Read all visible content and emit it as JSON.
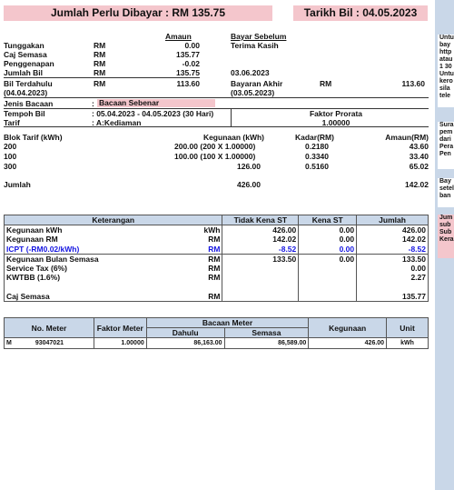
{
  "header": {
    "total_due": "Jumlah Perlu Dibayar : RM 135.75",
    "bill_date": "Tarikh Bil : 04.05.2023"
  },
  "summary": {
    "col_amount": "Amaun",
    "col_pay_before": "Bayar Sebelum",
    "thanks": "Terima Kasih",
    "rows": [
      {
        "label": "Tunggakan",
        "unit": "RM",
        "amount": "0.00"
      },
      {
        "label": "Caj Semasa",
        "unit": "RM",
        "amount": "135.77"
      },
      {
        "label": "Penggenapan",
        "unit": "RM",
        "amount": "-0.02"
      },
      {
        "label": "Jumlah Bil",
        "unit": "RM",
        "amount": "135.75",
        "date": "03.06.2023"
      }
    ],
    "prev_bill_label": "Bil Terdahulu",
    "prev_bill_date": "(04.04.2023)",
    "prev_bill_unit": "RM",
    "prev_bill_amount": "113.60",
    "last_payment_label": "Bayaran Akhir",
    "last_payment_date": "(03.05.2023)",
    "last_payment_unit": "RM",
    "last_payment_amount": "113.60"
  },
  "reading": {
    "type_label": "Jenis Bacaan",
    "type_value": "Bacaan Sebenar",
    "period_label": "Tempoh Bil",
    "period_value": ": 05.04.2023 - 04.05.2023 (30 Hari)",
    "tariff_label": "Tarif",
    "tariff_value": ": A:Kediaman",
    "prorate_label": "Faktor Prorata",
    "prorate_value": "1.00000"
  },
  "blocks": {
    "h_block": "Blok Tarif (kWh)",
    "h_usage": "Kegunaan (kWh)",
    "h_rate": "Kadar(RM)",
    "h_amount": "Amaun(RM)",
    "rows": [
      {
        "block": "200",
        "usage": "200.00  (200 X 1.00000)",
        "rate": "0.2180",
        "amount": "43.60"
      },
      {
        "block": "100",
        "usage": "100.00  (100 X 1.00000)",
        "rate": "0.3340",
        "amount": "33.40"
      },
      {
        "block": "300",
        "usage": "126.00",
        "rate": "0.5160",
        "amount": "65.02"
      }
    ],
    "total_label": "Jumlah",
    "total_usage": "426.00",
    "total_amount": "142.02"
  },
  "usage_table": {
    "headers": [
      "Keterangan",
      "Tidak Kena ST",
      "Kena ST",
      "Jumlah"
    ],
    "rows": [
      {
        "label": "Kegunaan kWh",
        "unit": "kWh",
        "a": "426.00",
        "b": "0.00",
        "c": "426.00"
      },
      {
        "label": "Kegunaan RM",
        "unit": "RM",
        "a": "142.02",
        "b": "0.00",
        "c": "142.02"
      },
      {
        "label": "ICPT (-RM0.02/kWh)",
        "unit": "RM",
        "a": "-8.52",
        "b": "0.00",
        "c": "-8.52"
      },
      {
        "label": "Kegunaan Bulan Semasa",
        "unit": "RM",
        "a": "133.50",
        "b": "0.00",
        "c": "133.50"
      },
      {
        "label": "Service Tax (6%)",
        "unit": "RM",
        "a": "",
        "b": "",
        "c": "0.00"
      },
      {
        "label": "KWTBB (1.6%)",
        "unit": "RM",
        "a": "",
        "b": "",
        "c": "2.27"
      },
      {
        "label": "Caj Semasa",
        "unit": "RM",
        "a": "",
        "b": "",
        "c": "135.77"
      }
    ]
  },
  "meter_table": {
    "h_meter": "No. Meter",
    "h_factor": "Faktor Meter",
    "h_reading": "Bacaan Meter",
    "h_prev": "Dahulu",
    "h_curr": "Semasa",
    "h_usage": "Kegunaan",
    "h_unit": "Unit",
    "row": {
      "type": "M",
      "meter": "93047021",
      "factor": "1.00000",
      "prev": "86,163.00",
      "curr": "86,589.00",
      "usage": "426.00",
      "unit": "kWh"
    }
  },
  "side": {
    "box1": "Untu bay http atau 1 30 Untu kero sila tele",
    "box2": "Sura pem dari Pera Pen",
    "box3": "Bay setel ban",
    "box4": "Jum sub Sub Kera"
  },
  "colors": {
    "pink": "#f4c6cc",
    "header_blue": "#c9d7e8",
    "icpt_blue": "#1515e0"
  }
}
